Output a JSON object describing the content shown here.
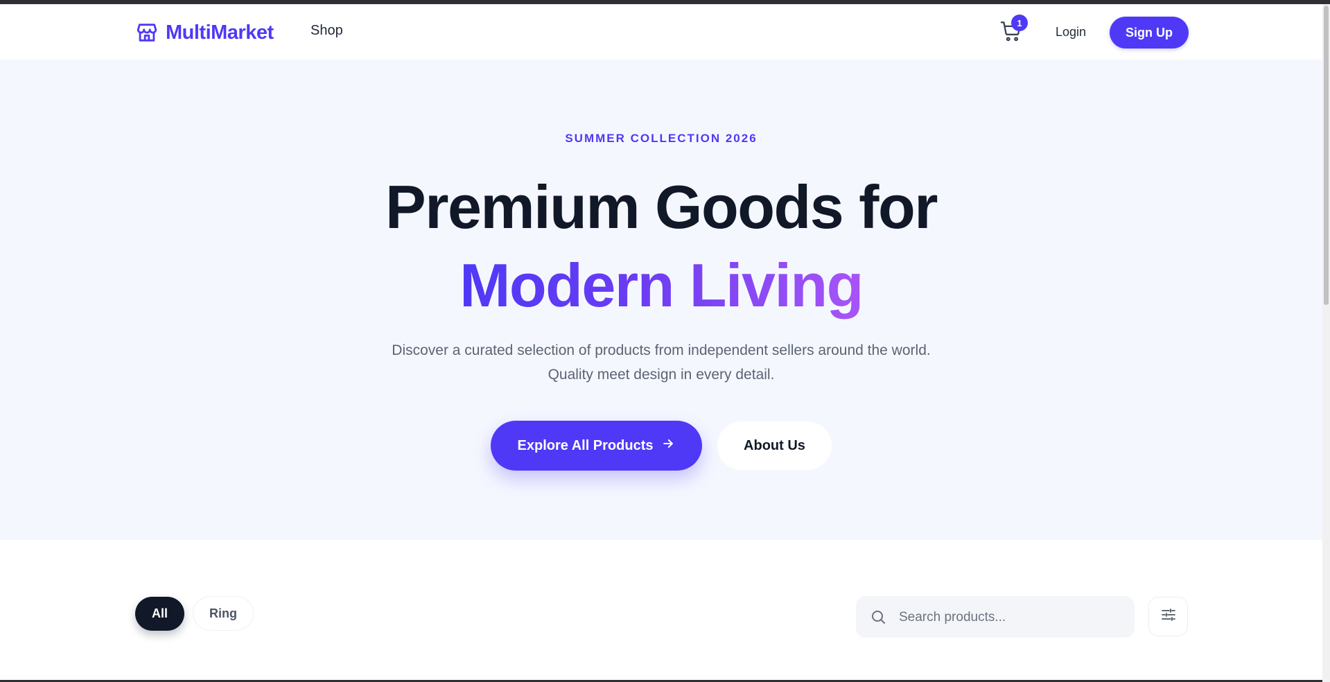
{
  "header": {
    "brand": "MultiMarket",
    "nav_shop": "Shop",
    "cart_count": "1",
    "login": "Login",
    "signup": "Sign Up"
  },
  "hero": {
    "kicker": "SUMMER COLLECTION 2026",
    "headline_line1": "Premium Goods for",
    "headline_line2": "Modern Living",
    "subtext": "Discover a curated selection of products from independent sellers around the world. Quality meet design in every detail.",
    "primary_cta": "Explore All Products",
    "secondary_cta": "About Us"
  },
  "filters": {
    "categories": [
      {
        "label": "All",
        "selected": true
      },
      {
        "label": "Ring",
        "selected": false
      }
    ],
    "search_placeholder": "Search products...",
    "search_value": ""
  },
  "colors": {
    "accent": "#4f39f6",
    "accent_gradient_end": "#a855f7",
    "dark": "#111827",
    "hero_bg": "#f5f7ff"
  },
  "icons": {
    "logo": "storefront-icon",
    "cart": "shopping-cart-icon",
    "cta_arrow": "arrow-right-icon",
    "search": "search-icon",
    "filter": "sliders-icon"
  }
}
